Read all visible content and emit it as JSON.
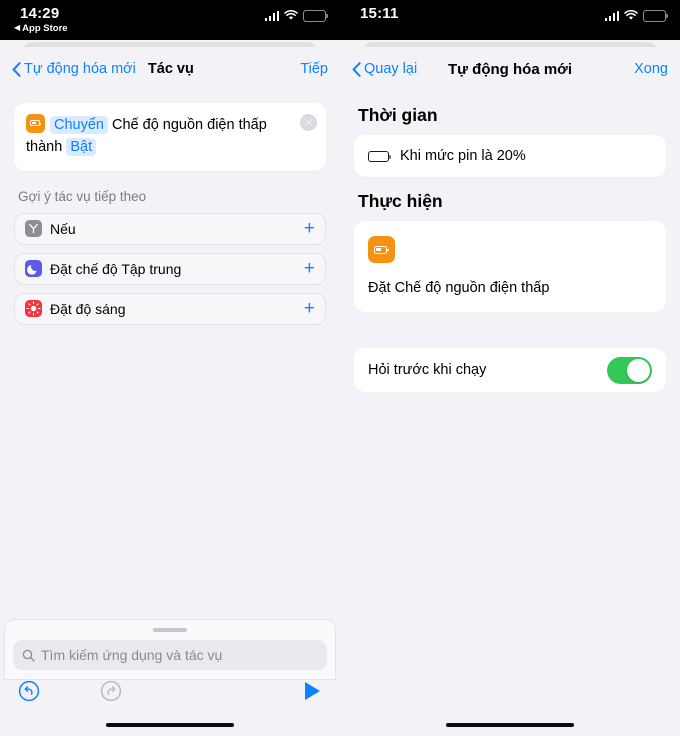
{
  "left": {
    "status": {
      "time": "14:29",
      "back_app": "App Store",
      "back_triangle": "◀",
      "cellular_icon": "cellular-signal-icon",
      "wifi_icon": "wifi-icon",
      "battery_icon": "battery-icon",
      "battery_color": "#ffffff",
      "battery_fill_pct": 58
    },
    "nav": {
      "back_label": "Tự động hóa mới",
      "title": "Tác vụ",
      "right_label": "Tiếp"
    },
    "action_card": {
      "icon": "low-power-mode-icon",
      "icon_color": "#f59211",
      "token1": "Chuyển",
      "mid_text": "Chế độ nguồn điện thấp thành",
      "token2": "Bật",
      "close_icon": "close-circle-icon"
    },
    "suggestions_label": "Gợi ý tác vụ tiếp theo",
    "suggestions": [
      {
        "label": "Nếu",
        "icon": "if-branch-icon",
        "color": "#8e8e93",
        "add_icon": "plus-icon",
        "add_label": "+"
      },
      {
        "label": "Đặt chế độ Tập trung",
        "icon": "moon-focus-icon",
        "color": "#5e5ce6",
        "add_icon": "plus-icon",
        "add_label": "+"
      },
      {
        "label": "Đặt độ sáng",
        "icon": "brightness-sun-icon",
        "color": "#f5333f",
        "add_icon": "plus-icon",
        "add_label": "+"
      }
    ],
    "search": {
      "placeholder": "Tìm kiếm ứng dụng và tác vụ",
      "value": "",
      "icon": "search-icon"
    },
    "toolbar": {
      "undo_icon": "undo-icon",
      "redo_icon": "redo-icon",
      "play_icon": "play-icon",
      "undo_color": "#0a84ff",
      "redo_color": "#b9b9bf",
      "play_color": "#0a84ff"
    }
  },
  "right": {
    "status": {
      "time": "15:11",
      "cellular_icon": "cellular-signal-icon",
      "wifi_icon": "wifi-icon",
      "battery_icon": "battery-icon",
      "battery_color": "#ffd60a",
      "battery_fill_pct": 52
    },
    "nav": {
      "back_label": "Quay lại",
      "title": "Tự động hóa mới",
      "right_label": "Xong"
    },
    "section_time": {
      "title": "Thời gian",
      "row_text": "Khi mức pin là 20%",
      "icon": "battery-level-icon"
    },
    "section_action": {
      "title": "Thực hiện",
      "icon": "low-power-mode-icon",
      "icon_color": "#f59211",
      "label": "Đặt Chế độ nguồn điện thấp"
    },
    "ask_row": {
      "label": "Hỏi trước khi chạy",
      "toggle_on": true,
      "toggle_color": "#34c759"
    }
  }
}
